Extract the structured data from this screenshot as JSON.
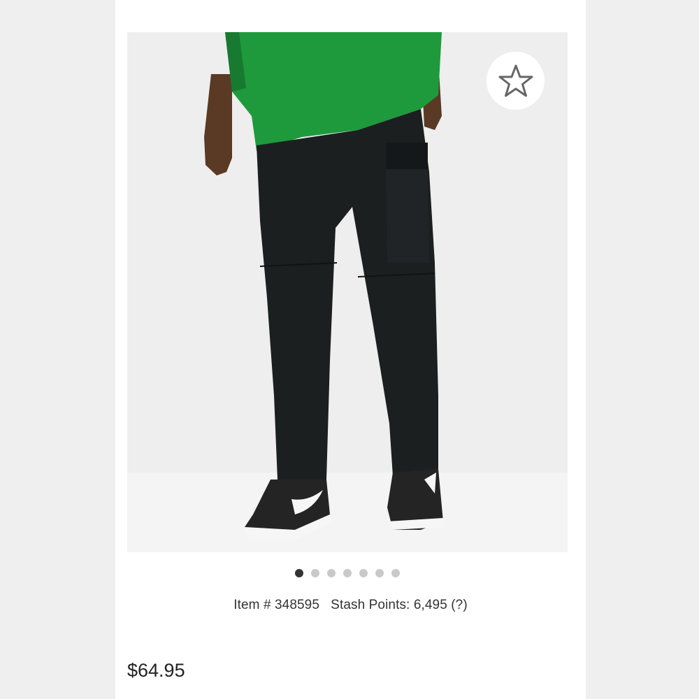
{
  "product": {
    "image_alt": "Model wearing black cargo pants with green t-shirt and black sneakers",
    "gallery_count": 7,
    "gallery_active_index": 0,
    "item_label": "Item #",
    "item_number": "348595",
    "stash_label": "Stash Points:",
    "stash_points": "6,495",
    "help_text": "(?)",
    "price": "$64.95"
  },
  "icons": {
    "favorite": "star-outline-icon"
  },
  "colors": {
    "background": "#f2f2f2",
    "card": "#ffffff",
    "dot_active": "#333333",
    "dot_inactive": "#c9c9c9",
    "shirt": "#1e9a3c",
    "pants": "#1c1f20"
  }
}
